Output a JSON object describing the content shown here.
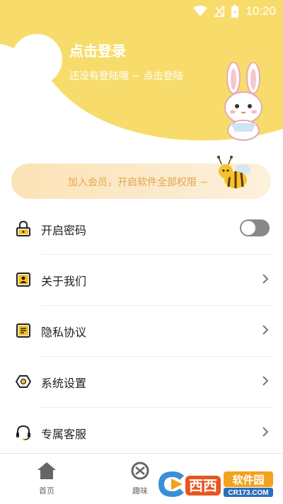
{
  "status_bar": {
    "time": "10:20",
    "icons": [
      "wifi-icon",
      "signal-icon",
      "battery-icon"
    ]
  },
  "header": {
    "login_title": "点击登录",
    "login_subtitle": "还没有登陆哦 ~ 点击登陆"
  },
  "vip_banner": {
    "text": "加入会员，开启软件全部权限 ~"
  },
  "menu": [
    {
      "label": "开启密码",
      "icon": "lock-icon",
      "control": "toggle",
      "toggle_on": false
    },
    {
      "label": "关于我们",
      "icon": "contact-card-icon",
      "control": "chevron"
    },
    {
      "label": "隐私协议",
      "icon": "document-icon",
      "control": "chevron"
    },
    {
      "label": "系统设置",
      "icon": "settings-hexagon-icon",
      "control": "chevron"
    },
    {
      "label": "专属客服",
      "icon": "headset-icon",
      "control": "chevron"
    }
  ],
  "bottom_nav": [
    {
      "label": "首页",
      "icon": "home-icon"
    },
    {
      "label": "趣味",
      "icon": "fun-icon"
    }
  ],
  "watermark": {
    "brand": "西西",
    "site": "软件园",
    "url": "CR173.COM"
  },
  "colors": {
    "accent_yellow": "#f8dc6b",
    "vip_text": "#e3a64c",
    "toggle_off": "#888888"
  }
}
